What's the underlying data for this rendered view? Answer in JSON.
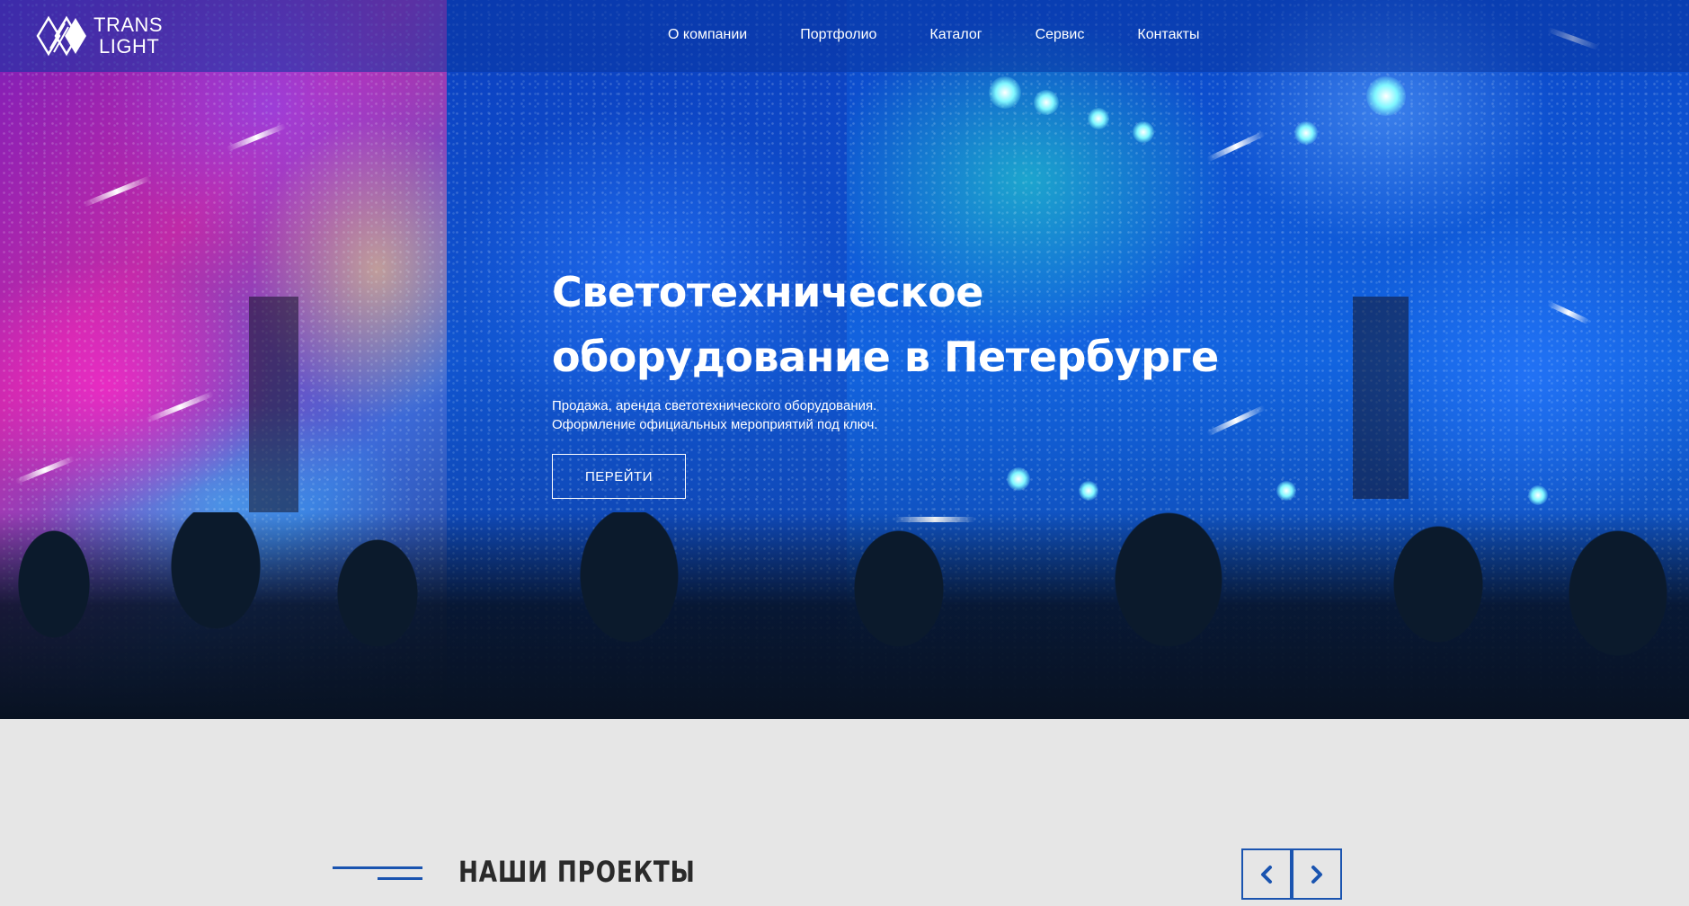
{
  "brand": {
    "line1": "TRANS",
    "line2": "LIGHT"
  },
  "nav": {
    "items": [
      {
        "label": "О компании"
      },
      {
        "label": "Портфолио"
      },
      {
        "label": "Каталог"
      },
      {
        "label": "Сервис"
      },
      {
        "label": "Контакты"
      }
    ]
  },
  "hero": {
    "title_line1": "Светотехническое",
    "title_line2": "оборудование в Петербурге",
    "subtitle_line1": "Продажа, аренда светотехнического оборудования.",
    "subtitle_line2": "Оформление официальных мероприятий под ключ.",
    "cta_label": "ПЕРЕЙТИ"
  },
  "projects": {
    "title": "НАШИ ПРОЕКТЫ",
    "prev_icon": "chevron-left-icon",
    "next_icon": "chevron-right-icon"
  },
  "colors": {
    "accent": "#1a54b0",
    "page_bg": "#e6e6e6",
    "hero_blue": "#0f46c4"
  }
}
